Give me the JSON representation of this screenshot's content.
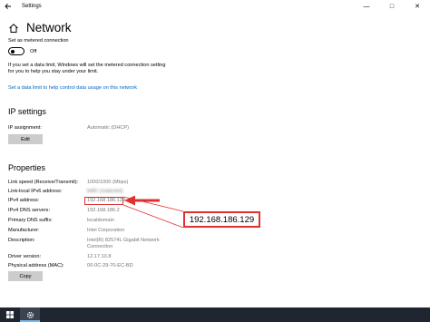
{
  "window": {
    "title": "Settings",
    "back_icon": "back-arrow-icon",
    "controls": {
      "minimize": "—",
      "maximize": "□",
      "close": "✕"
    }
  },
  "page": {
    "title": "Network",
    "home_icon": "home-icon"
  },
  "metered": {
    "label": "Set as metered connection",
    "toggle_state": "Off",
    "description_line1": "If you set a data limit, Windows will set the metered connection setting",
    "description_line2": "for you to help you stay under your limit.",
    "link": "Set a data limit to help control data usage on this network"
  },
  "ip_settings": {
    "heading": "IP settings",
    "assignment_label": "IP assignment:",
    "assignment_value": "Automatic (DHCP)",
    "edit_button": "Edit"
  },
  "properties": {
    "heading": "Properties",
    "rows": [
      {
        "label": "Link speed (Receive/Transmit):",
        "value": "1000/1000 (Mbps)"
      },
      {
        "label": "Link-local IPv6 address:",
        "value": "fe80::(redacted)"
      },
      {
        "label": "IPv4 address:",
        "value": "192.168.186.129"
      },
      {
        "label": "IPv4 DNS servers:",
        "value": "192.168.186.2"
      },
      {
        "label": "Primary DNS suffix:",
        "value": "localdomain"
      },
      {
        "label": "Manufacturer:",
        "value": "Intel Corporation"
      },
      {
        "label": "Description:",
        "value": "Intel(R) 82574L Gigabit Network",
        "value2": "Connection"
      },
      {
        "label": "Driver version:",
        "value": "12.17.10.8"
      },
      {
        "label": "Physical address (MAC):",
        "value": "00-0C-29-70-EC-BD"
      }
    ],
    "copy_button": "Copy"
  },
  "annotation": {
    "callout_text": "192.168.186.129",
    "color": "#e03030"
  },
  "taskbar": {
    "start_icon": "windows-logo-icon",
    "settings_icon": "gear-icon",
    "background": "#1f2630"
  }
}
